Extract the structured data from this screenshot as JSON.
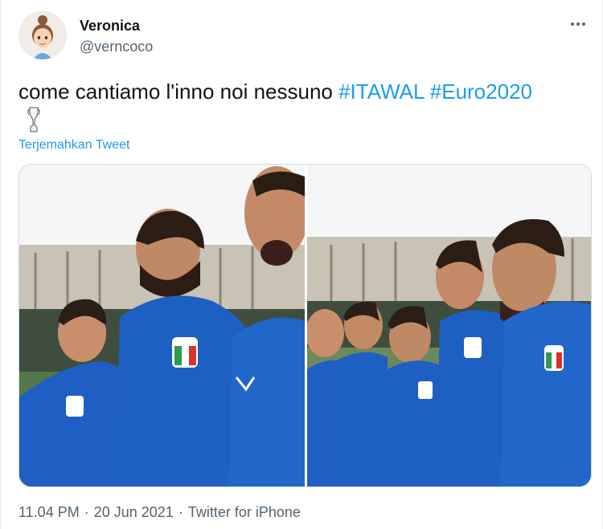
{
  "user": {
    "display_name": "Veronica",
    "handle": "@verncoco",
    "avatar_icon": "memoji-avatar-icon"
  },
  "tweet": {
    "text": "come cantiamo l'inno noi nessuno ",
    "hashtags": [
      "#ITAWAL",
      "#Euro2020"
    ],
    "emoji_icon": "trophy-icon",
    "translate_label": "Terjemahkan Tweet"
  },
  "media": {
    "photos": [
      {
        "description_icon": "photo-left"
      },
      {
        "description_icon": "photo-right"
      }
    ]
  },
  "meta": {
    "time": "11.04 PM",
    "date": "20 Jun 2021",
    "source": "Twitter for iPhone",
    "separator": "·"
  },
  "colors": {
    "link": "#1d9bf0",
    "secondary_text": "#536471",
    "jersey_blue": "#1e5fc2"
  }
}
